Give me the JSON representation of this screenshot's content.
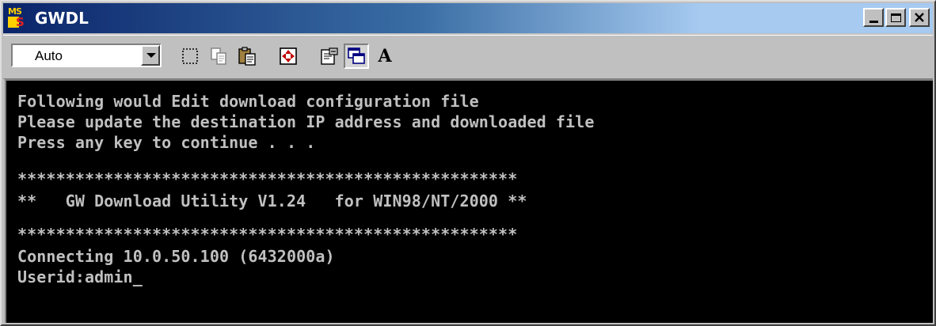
{
  "window": {
    "title": "GWDL",
    "icon": "ms-dos-icon",
    "controls": [
      "minimize-icon",
      "maximize-icon",
      "close-icon"
    ]
  },
  "toolbar": {
    "font_size_value": "Auto",
    "buttons": [
      "mark-icon",
      "copy-icon",
      "paste-icon",
      "fullscreen-icon",
      "properties-icon",
      "background-icon",
      "font-icon"
    ],
    "font_button_label": "A"
  },
  "console": {
    "lines": [
      "Following would Edit download configuration file",
      "Please update the destination IP address and downloaded file",
      "Press any key to continue . . .",
      "",
      "****************************************************",
      "**   GW Download Utility V1.24   for WIN98/NT/2000 **",
      "",
      "****************************************************",
      "Connecting 10.0.50.100 (6432000a)",
      "Userid:admin_"
    ],
    "text_color": "#c0c0c0",
    "background_color": "#000000"
  },
  "colors": {
    "titlebar_start": "#0a246a",
    "titlebar_end": "#a6caf0",
    "chrome": "#c0c0c0"
  }
}
